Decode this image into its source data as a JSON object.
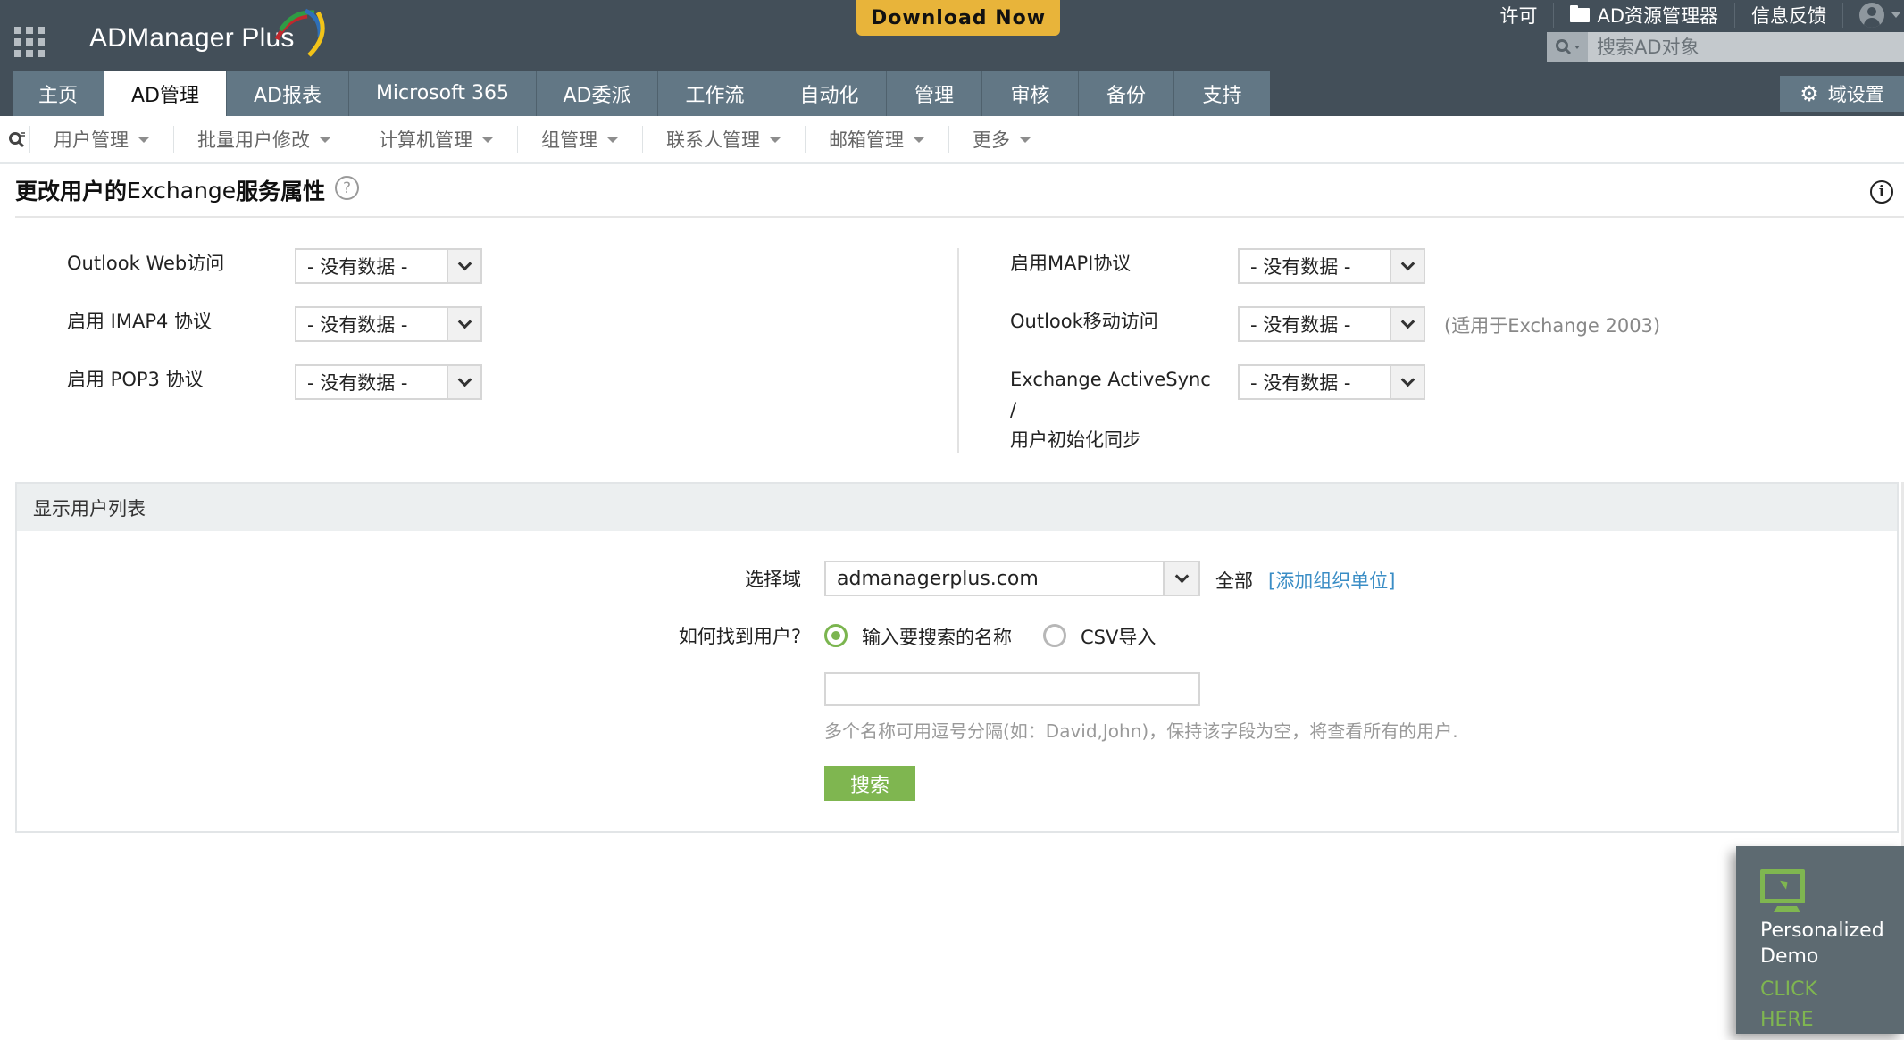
{
  "app": {
    "name": "ADManager Plus",
    "download_label": "Download Now"
  },
  "top_links": {
    "license": "许可",
    "ad_explorer": "AD资源管理器",
    "feedback": "信息反馈"
  },
  "search": {
    "placeholder": "搜索AD对象"
  },
  "nav_tabs": [
    {
      "label": "主页",
      "active": false
    },
    {
      "label": "AD管理",
      "active": true
    },
    {
      "label": "AD报表",
      "active": false
    },
    {
      "label": "Microsoft 365",
      "active": false
    },
    {
      "label": "AD委派",
      "active": false
    },
    {
      "label": "工作流",
      "active": false
    },
    {
      "label": "自动化",
      "active": false
    },
    {
      "label": "管理",
      "active": false
    },
    {
      "label": "审核",
      "active": false
    },
    {
      "label": "备份",
      "active": false
    },
    {
      "label": "支持",
      "active": false
    }
  ],
  "domain_settings_label": "域设置",
  "sub_nav": [
    {
      "label": "用户管理"
    },
    {
      "label": "批量用户修改"
    },
    {
      "label": "计算机管理"
    },
    {
      "label": "组管理"
    },
    {
      "label": "联系人管理"
    },
    {
      "label": "邮箱管理"
    },
    {
      "label": "更多"
    }
  ],
  "page": {
    "title_part1": "更改用户的",
    "title_part2": "Exchange",
    "title_part3": "服务属性",
    "help": "?",
    "info": "i"
  },
  "form": {
    "left": [
      {
        "label": "Outlook Web访问",
        "value": "- 没有数据 -"
      },
      {
        "label": "启用 IMAP4 协议",
        "value": "- 没有数据 -"
      },
      {
        "label": "启用 POP3 协议",
        "value": "- 没有数据 -"
      }
    ],
    "right": [
      {
        "label": "启用MAPI协议",
        "value": "- 没有数据 -"
      },
      {
        "label": "Outlook移动访问",
        "value": "- 没有数据 -",
        "note": "(适用于Exchange 2003)"
      },
      {
        "label_line1": "Exchange ActiveSync",
        "label_line2": "/",
        "label_line3": "用户初始化同步",
        "value": "- 没有数据 -"
      }
    ]
  },
  "user_list": {
    "header": "显示用户列表",
    "domain_label": "选择域",
    "domain_value": "admanagerplus.com",
    "all_label": "全部",
    "add_ou_link": "[添加组织单位]",
    "find_label": "如何找到用户?",
    "radio_options": [
      {
        "label": "输入要搜索的名称",
        "selected": true
      },
      {
        "label": "CSV导入",
        "selected": false
      }
    ],
    "names_value": "",
    "hint": "多个名称可用逗号分隔(如：David,John)，保持该字段为空，将查看所有的用户.",
    "search_button": "搜索"
  },
  "demo_widget": {
    "title_line1": "Personalized",
    "title_line2": "Demo",
    "cta_line1": "CLICK",
    "cta_line2": "HERE"
  },
  "colors": {
    "topbar": "#434f59",
    "tab": "#627785",
    "download": "#e8b43a",
    "accent_green": "#7fb650",
    "link": "#3a8dc5"
  }
}
